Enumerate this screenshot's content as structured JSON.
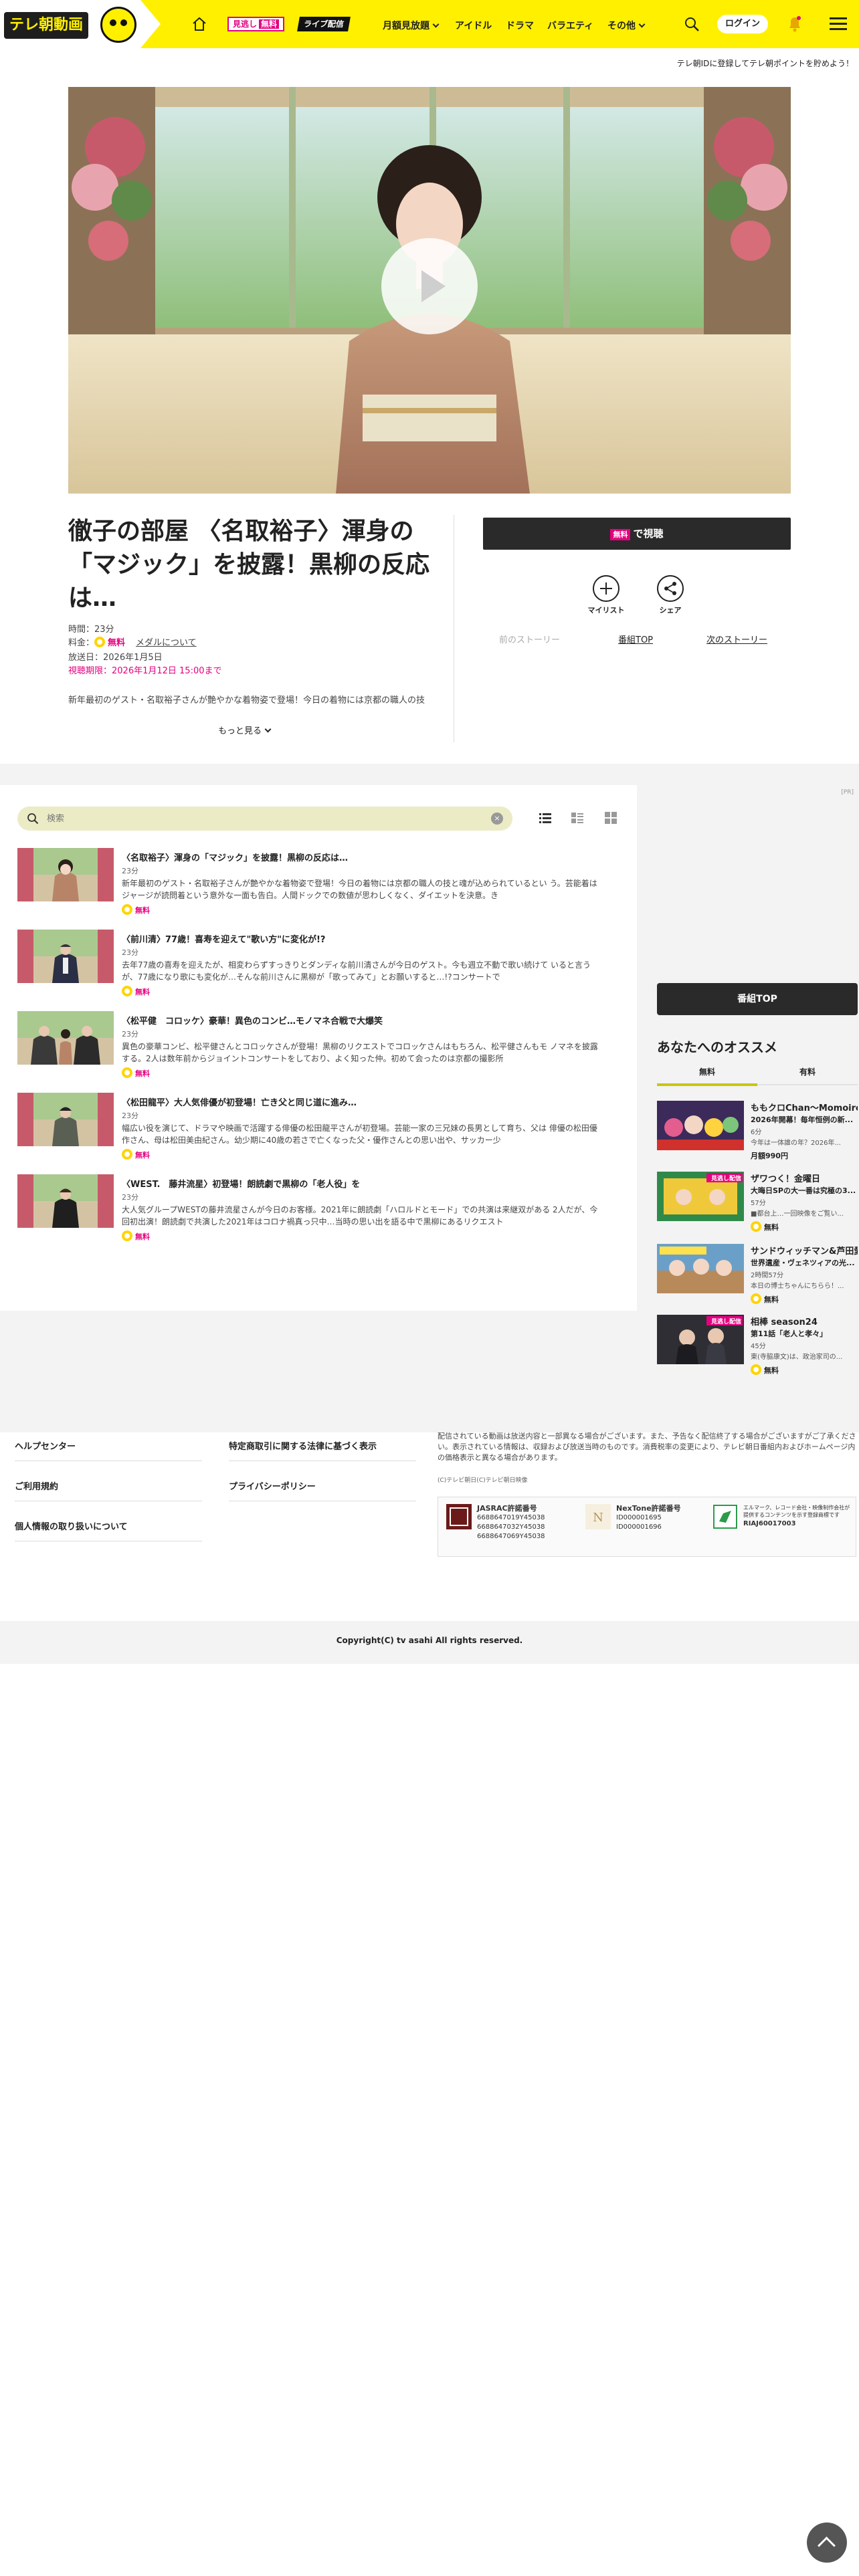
{
  "header": {
    "logo_text": "テレ朝動画",
    "mitsune_label": "見逃し",
    "mitsune_free": "無料",
    "live_label": "ライブ配信",
    "nav": [
      {
        "label": "月額見放題",
        "dropdown": true
      },
      {
        "label": "アイドル",
        "dropdown": false
      },
      {
        "label": "ドラマ",
        "dropdown": false
      },
      {
        "label": "バラエティ",
        "dropdown": false
      },
      {
        "label": "その他",
        "dropdown": true
      }
    ],
    "login_label": "ログイン"
  },
  "promo_text": "テレ朝IDに登録してテレ朝ポイントを貯めよう！",
  "episode": {
    "title": "徹子の部屋 〈名取裕子〉渾身の「マジック」を披露！黒柳の反応は…",
    "duration": "時間：23分",
    "price_prefix": "料金：",
    "price_free": "無料",
    "media_link": "メダルについて",
    "air_date": "放送日：2026年1月5日",
    "deadline": "視聴期限：2026年1月12日 15:00まで",
    "description": "新年最初のゲスト・名取裕子さんが艶やかな着物姿で登場！今日の着物には京都の職人の技",
    "more_label": "もっと見る",
    "watch_free": "無料",
    "watch_label": "で視聴",
    "mylist_label": "マイリスト",
    "share_label": "シェア",
    "prev_story": "前のストーリー",
    "program_top": "番組TOP",
    "next_story": "次のストーリー"
  },
  "search": {
    "placeholder": "検索"
  },
  "episode_list": [
    {
      "title": "〈名取裕子〉渾身の「マジック」を披露！黒柳の反応は…",
      "duration": "23分",
      "desc": "新年最初のゲスト・名取裕子さんが艶やかな着物姿で登場！今日の着物には京都の職人の技と魂が込められているとい う。芸能着はジャージが読問着という意外な一面も告白。人間ドックでの数値が思わしくなく、ダイエットを決意。き",
      "free": "無料"
    },
    {
      "title": "〈前川清〉77歳！喜寿を迎えて\"歌い方\"に変化が!?",
      "duration": "23分",
      "desc": "去年77歳の喜寿を迎えたが、相変わらずすっきりとダンディな前川清さんが今日のゲスト。今も週立不動で歌い続けて いると言うが、77歳になり歌にも変化が…そんな前川さんに黒柳が「歌ってみて」とお願いすると…!?コンサートで",
      "free": "無料"
    },
    {
      "title": "〈松平健　コロッケ〉豪華！異色のコンビ…モノマネ合戦で大爆笑",
      "duration": "23分",
      "desc": "異色の豪華コンビ、松平健さんとコロッケさんが登場！黒柳のリクエストでコロッケさんはもちろん、松平健さんもモ ノマネを披露する。2人は数年前からジョイントコンサートをしており、よく知った仲。初めて会ったのは京都の撮影所",
      "free": "無料"
    },
    {
      "title": "〈松田龍平〉大人気俳優が初登場！亡き父と同じ道に進み…",
      "duration": "23分",
      "desc": "幅広い役を演じて、ドラマや映画で活躍する俳優の松田龍平さんが初登場。芸能一家の三兄妹の長男として育ち、父は 俳優の松田優作さん、母は松田美由紀さん。幼少期に40歳の若さで亡くなった父・優作さんとの思い出や、サッカー少",
      "free": "無料"
    },
    {
      "title": "〈WEST.　藤井流星〉初登場！朗読劇で黒柳の「老人役」を",
      "duration": "23分",
      "desc": "大人気グループWESTの藤井流星さんが今日のお客様。2021年に朗読劇「ハロルドとモード」での共演は来継双がある 2人だが、今回初出演！朗読劇で共演した2021年はコロナ禍真っ只中…当時の思い出を語る中で黒柳にあるリクエスト",
      "free": "無料"
    }
  ],
  "ad_label": "[PR]",
  "program_top_button": "番組TOP",
  "recommend": {
    "title": "あなたへのオススメ",
    "tab_free": "無料",
    "tab_paid": "有料",
    "items": [
      {
        "title": "ももクロChan～Momoiro Clover Z Channel～",
        "subtitle": "2026年開幕！毎年恒例の新...",
        "meta": "6分\n今年は一体誰の年？2026年...",
        "foot": "月額990円",
        "badge": ""
      },
      {
        "title": "ザワつく！金曜日",
        "subtitle": "大晦日SPの大一番は究極の3...",
        "meta": "57分\n■都台上…一回映像をご覧い...",
        "foot": "無料",
        "badge": "見逃し配信"
      },
      {
        "title": "サンドウィッチマン&芦田愛菜の博士ちゃん",
        "subtitle": "世界遺産・ヴェネツィアの光...",
        "meta": "2時間57分\n本日の博士ちゃんにちらら！...",
        "foot": "無料",
        "badge": ""
      },
      {
        "title": "相棒 season24",
        "subtitle": "第11話「老人と孝々」",
        "meta": "45分\n東(寺脇康文)は、政治家司の...",
        "foot": "無料",
        "badge": "見逃し配信"
      }
    ]
  },
  "footer": {
    "links_col1": [
      "ヘルプセンター",
      "ご利用規約",
      "個人情報の取り扱いについて"
    ],
    "links_col2": [
      "特定商取引に関する法律に基づく表示",
      "プライバシーポリシー"
    ],
    "legal": "配信されている動画は放送内容と一部異なる場合がございます。また、予告なく配信終了する場合がございますがご了承ください。表示されている情報は、収録および放送当時のものです。消費税率の変更により、テレビ朝日番組内およびホームページ内の価格表示と異なる場合があります。",
    "legal_copy": "(C)テレビ朝日(C)テレビ朝日映像",
    "jasrac_title": "JASRAC許諾番号",
    "jasrac_numbers": "6688647019Y45038\n6688647032Y45038\n6688647069Y45038",
    "nextone_title": "NexTone許諾番号",
    "nextone_numbers": "ID000001695\nID000001696",
    "riaj_text": "エルマーク、レコード会社・映像制作会社が提供するコンテンツを示す登録商標です",
    "riaj_number": "RIAJ60017003",
    "copyright": "Copyright(C) tv asahi All rights reserved."
  },
  "colors": {
    "brand_yellow": "#fff000",
    "accent_pink": "#e4007f",
    "dark_button": "#2a2a2a",
    "free_tab_underline": "#c8c800"
  }
}
